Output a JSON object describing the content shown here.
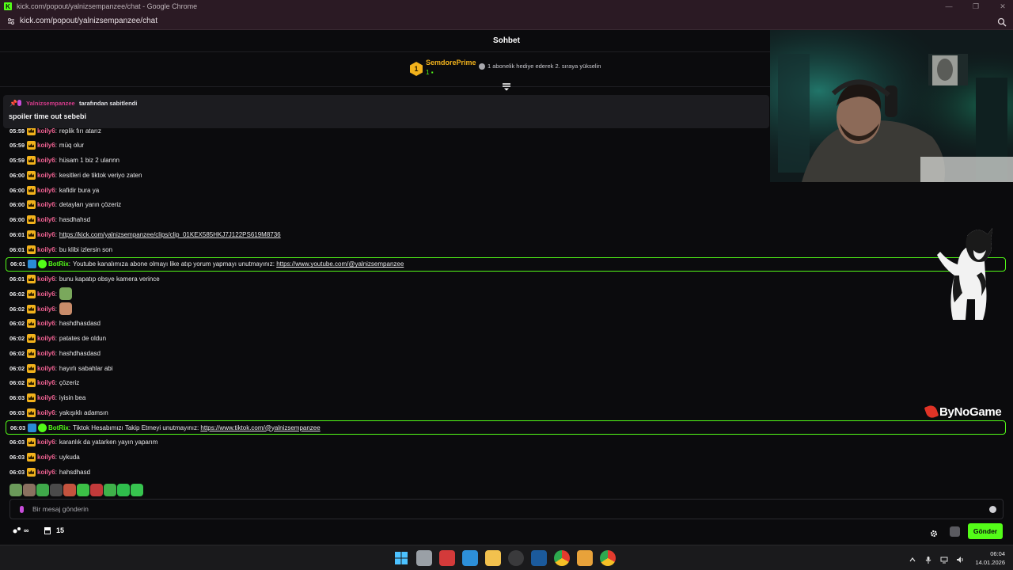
{
  "browser": {
    "window_title": "kick.com/popout/yalnizsempanzee/chat - Google Chrome",
    "url": "kick.com/popout/yalnizsempanzee/chat",
    "window_controls": [
      "—",
      "❐",
      "✕"
    ]
  },
  "chat": {
    "title": "Sohbet",
    "leaderboard": {
      "rank": "1",
      "username": "SemdorePrime",
      "gift_count": "1",
      "cta": "1 abonelik hediye ederek 2. sıraya yükselin"
    },
    "pinned": {
      "username": "Yalnizsempanzee",
      "pinned_by_suffix": "tarafından sabitlendi",
      "message": "spoiler time out sebebi"
    },
    "messages": [
      {
        "time": "05:59",
        "user": "koily6",
        "text": "replik fırı atarız",
        "type": "user"
      },
      {
        "time": "05:59",
        "user": "koily6",
        "text": "müq olur",
        "type": "user"
      },
      {
        "time": "05:59",
        "user": "koily6",
        "text": "hüsam 1 biz 2 ulannn",
        "type": "user"
      },
      {
        "time": "06:00",
        "user": "koily6",
        "text": "kesitleri de tiktok veriyo zaten",
        "type": "user"
      },
      {
        "time": "06:00",
        "user": "koily6",
        "text": "kafidir bura ya",
        "type": "user"
      },
      {
        "time": "06:00",
        "user": "koily6",
        "text": "detayları yarın çözeriz",
        "type": "user"
      },
      {
        "time": "06:00",
        "user": "koily6",
        "text": "hasdhahsd",
        "type": "user"
      },
      {
        "time": "06:01",
        "user": "koily6",
        "text": "",
        "link": "https://kick.com/yalnizsempanzee/clips/clip_01KEX585HKJ7J122PS619M8736",
        "type": "user"
      },
      {
        "time": "06:01",
        "user": "koily6",
        "text": "bu klibi izlersin son",
        "type": "user"
      },
      {
        "time": "06:01",
        "user": "BotRix",
        "text": "Youtube kanalımıza abone olmayı like atıp yorum yapmayı unutmayınız: ",
        "link": "https://www.youtube.com/@yalnizsempanzee",
        "type": "bot"
      },
      {
        "time": "06:01",
        "user": "koily6",
        "text": "bunu kapatıp obsye kamera verince",
        "type": "user"
      },
      {
        "time": "06:02",
        "user": "koily6",
        "text": "",
        "emote": "pepe-emote",
        "type": "emote"
      },
      {
        "time": "06:02",
        "user": "koily6",
        "text": "",
        "emote": "face-emote",
        "type": "emote"
      },
      {
        "time": "06:02",
        "user": "koily6",
        "text": "hashdhasdasd",
        "type": "user"
      },
      {
        "time": "06:02",
        "user": "koily6",
        "text": "patates de oldun",
        "type": "user"
      },
      {
        "time": "06:02",
        "user": "koily6",
        "text": "hashdhasdasd",
        "type": "user"
      },
      {
        "time": "06:02",
        "user": "koily6",
        "text": "hayırlı sabahlar abi",
        "type": "user"
      },
      {
        "time": "06:02",
        "user": "koily6",
        "text": "çözeriz",
        "type": "user"
      },
      {
        "time": "06:03",
        "user": "koily6",
        "text": "iyisin bea",
        "type": "user"
      },
      {
        "time": "06:03",
        "user": "koily6",
        "text": "yakışıklı adamsın",
        "type": "user"
      },
      {
        "time": "06:03",
        "user": "BotRix",
        "text": "Tiktok Hesabımızı Takip Etmeyi unutmayınız: ",
        "link": "https://www.tiktok.com/@yalnizsempanzee",
        "type": "bot"
      },
      {
        "time": "06:03",
        "user": "koily6",
        "text": "karanlık da yatarken yayın yaparım",
        "type": "user"
      },
      {
        "time": "06:03",
        "user": "koily6",
        "text": "uykuda",
        "type": "user"
      },
      {
        "time": "06:03",
        "user": "koily6",
        "text": "hahsdhasd",
        "type": "user"
      }
    ],
    "input": {
      "placeholder": "Bir mesaj gönderin"
    },
    "footer": {
      "points_value": "∞",
      "store_count": "15",
      "send_label": "Gönder"
    },
    "watermark": "ByNoGame"
  },
  "taskbar": {
    "time": "06:04",
    "date": "14.01.2026",
    "apps": [
      "start-icon",
      "task-view-icon",
      "snipping-tool-icon",
      "photos-icon",
      "file-explorer-icon",
      "obs-icon",
      "steam-icon",
      "chrome-icon",
      "media-player-icon",
      "chrome-profile-icon"
    ]
  },
  "colors": {
    "accent": "#53fc18",
    "username": "#f06292",
    "gold": "#f2b21c",
    "pinned_user": "#d43b8a"
  }
}
